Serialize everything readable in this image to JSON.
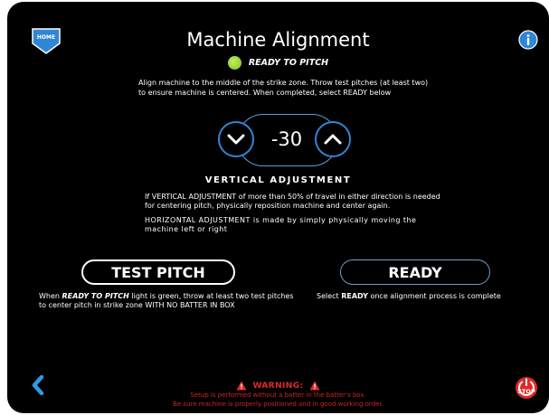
{
  "header": {
    "home_label": "HOME",
    "title": "Machine Alignment",
    "status_text": "READY TO PITCH",
    "status_color": "#a6db3f"
  },
  "instructions": "Align machine to the middle of the strike zone. Throw test pitches (at least two) to ensure machine is centered. When completed, select READY below",
  "vertical_adjustment": {
    "value": "-30",
    "label": "VERTICAL ADJUSTMENT",
    "note": "If VERTICAL ADJUSTMENT of more than 50% of travel in either direction is needed for centering pitch, physically reposition machine and center again.",
    "horizontal_note": "HORIZONTAL ADJUSTMENT is made by simply physically moving the machine left or right"
  },
  "actions": {
    "test_pitch_label": "TEST PITCH",
    "ready_label": "READY",
    "test_desc_bold": "READY TO PITCH",
    "test_desc_pre": "When ",
    "test_desc_post": " light is green, throw at least two test pitches to center pitch in strike zone WITH NO BATTER IN BOX",
    "ready_desc_pre": "Select ",
    "ready_desc_bold": "READY",
    "ready_desc_post": " once alignment process is complete"
  },
  "footer": {
    "stop_label": "STOP",
    "warning_title": "WARNING:",
    "warning_line1": "Setup is performed without a batter in the batter's box.",
    "warning_line2": "Be sure machine is properly positioned and in good working order."
  },
  "colors": {
    "accent_blue": "#2f86d6",
    "warning_red": "#e02a2a",
    "background": "#000000"
  },
  "icons": {
    "home": "home-shield-icon",
    "info": "info-icon",
    "down": "chevron-down-icon",
    "up": "chevron-up-icon",
    "back": "chevron-left-icon",
    "stop": "power-stop-icon",
    "warning": "warning-triangle-icon"
  }
}
